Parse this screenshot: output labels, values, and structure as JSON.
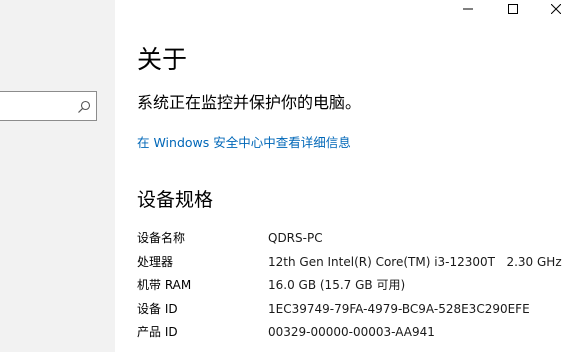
{
  "window": {
    "controls": {
      "minimize_glyph": "—",
      "maximize_glyph": "□",
      "close_glyph": "✕"
    }
  },
  "search": {
    "value": "",
    "icon": "search-icon"
  },
  "main": {
    "title": "关于",
    "status": "系统正在监控并保护你的电脑。",
    "security_link": "在 Windows 安全中心中查看详细信息",
    "specs_heading": "设备规格",
    "specs": [
      {
        "label": "设备名称",
        "value": "QDRS-PC"
      },
      {
        "label": "处理器",
        "value": "12th Gen Intel(R) Core(TM) i3-12300T   2.30 GHz"
      },
      {
        "label": "机带 RAM",
        "value": "16.0 GB (15.7 GB 可用)"
      },
      {
        "label": "设备 ID",
        "value": "1EC39749-79FA-4979-BC9A-528E3C290EFE"
      },
      {
        "label": "产品 ID",
        "value": "00329-00000-00003-AA941"
      }
    ]
  },
  "colors": {
    "link": "#0067b8",
    "sidebar_bg": "#f2f2f2"
  }
}
